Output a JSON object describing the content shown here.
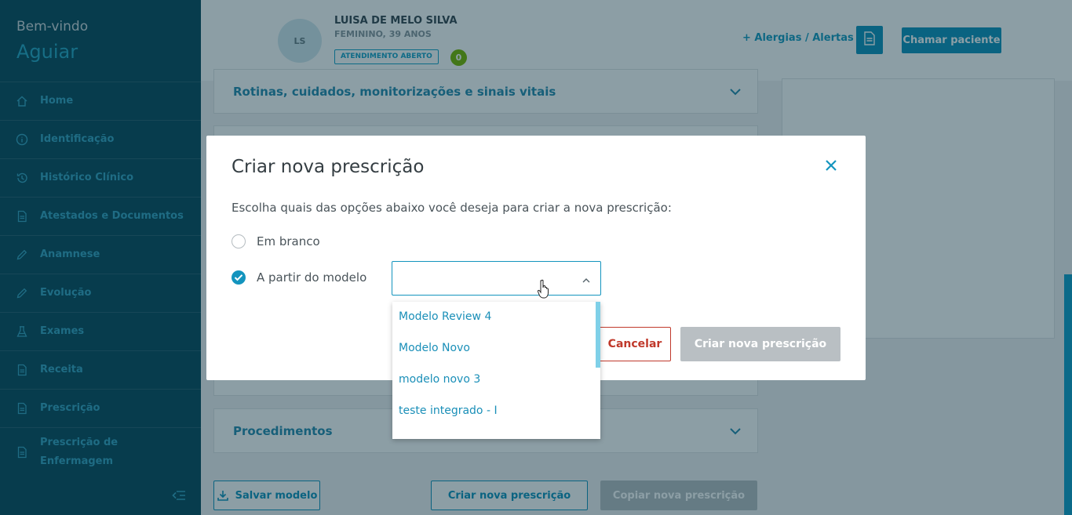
{
  "sidebar": {
    "welcome": "Bem-vindo",
    "unit": "Aguiar",
    "items": [
      {
        "label": "Home",
        "icon": "home-icon"
      },
      {
        "label": "Identificação",
        "icon": "info-icon"
      },
      {
        "label": "Histórico Clínico",
        "icon": "history-icon"
      },
      {
        "label": "Atestados e Documentos",
        "icon": "document-icon"
      },
      {
        "label": "Anamnese",
        "icon": "pencil-icon"
      },
      {
        "label": "Evolução",
        "icon": "pencil-icon"
      },
      {
        "label": "Exames",
        "icon": "flask-icon"
      },
      {
        "label": "Receita",
        "icon": "document-icon"
      },
      {
        "label": "Prescrição",
        "icon": "document-icon"
      },
      {
        "label_line1": "Prescrição de",
        "label_line2": "Enfermagem",
        "icon": "document-icon"
      }
    ]
  },
  "patient": {
    "initials": "LS",
    "name": "LUISA DE MELO SILVA",
    "info": "FEMININO, 39 ANOS",
    "status": "ATENDIMENTO ABERTO",
    "flag": "0",
    "allergies_label": "+ Alergias / Alertas",
    "call_label": "Chamar paciente"
  },
  "sections": {
    "routines": "Rotinas, cuidados, monitorizações e sinais vitais",
    "procedures": "Procedimentos"
  },
  "bottom_actions": {
    "save_model": "Salvar modelo",
    "create": "Criar nova prescrição",
    "copy": "Copiar nova prescrição"
  },
  "modal": {
    "title": "Criar nova prescrição",
    "description": "Escolha quais das opções abaixo você deseja para criar a nova prescrição:",
    "option_blank": "Em branco",
    "option_model": "A partir do modelo",
    "select_value": "",
    "cancel_label": "Cancelar",
    "create_label": "Criar nova prescrição",
    "dropdown_options": [
      "Modelo Review 4",
      "Modelo Novo",
      "modelo novo 3",
      "teste integrado - I"
    ]
  },
  "colors": {
    "sidebar_bg": "#0d4d5f",
    "accent": "#1394be",
    "danger": "#c0392b",
    "disabled": "#b9bfc3"
  }
}
